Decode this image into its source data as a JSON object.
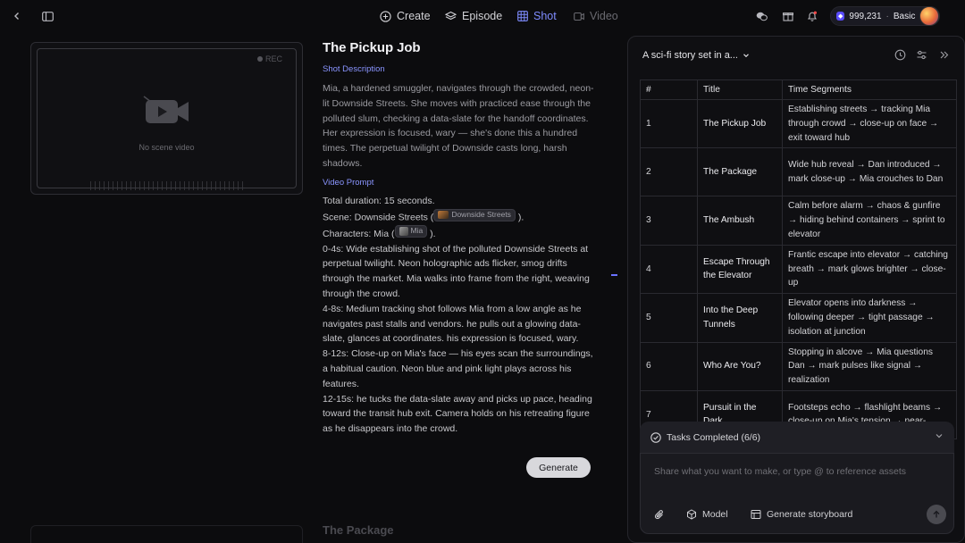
{
  "nav": {
    "create": "Create",
    "episode": "Episode",
    "shot": "Shot",
    "video": "Video"
  },
  "account": {
    "credits": "999,231",
    "plan": "Basic"
  },
  "preview": {
    "rec": "REC",
    "empty": "No scene video"
  },
  "shot": {
    "title": "The Pickup Job",
    "description_label": "Shot Description",
    "description": "Mia, a hardened smuggler, navigates through the crowded, neon-lit Downside Streets. She moves with practiced ease through the polluted slum, checking a data-slate for the handoff coordinates. Her expression is focused, wary — she's done this a hundred times. The perpetual twilight of Downside casts long, harsh shadows.",
    "prompt_label": "Video Prompt",
    "duration": "Total duration: 15 seconds.",
    "scene_prefix": "Scene: Downside Streets (",
    "scene_tag": "Downside Streets",
    "scene_suffix": ").",
    "characters_prefix": "Characters: Mia (",
    "character_tag": "Mia",
    "characters_suffix": ").",
    "beats": [
      "0-4s: Wide establishing shot of the polluted Downside Streets at perpetual twilight. Neon holographic ads flicker, smog drifts through the market. Mia walks into frame from the right, weaving through the crowd.",
      "4-8s: Medium tracking shot follows Mia from a low angle as he navigates past stalls and vendors. he pulls out a glowing data-slate, glances at coordinates. his expression is focused, wary.",
      "8-12s: Close-up on Mia's face — his eyes scan the surroundings, a habitual caution. Neon blue and pink light plays across his features.",
      "12-15s: he tucks the data-slate away and picks up pace, heading toward the transit hub exit. Camera holds on his retreating figure as he disappears into the crowd."
    ],
    "generate_label": "Generate"
  },
  "next_shot": {
    "title": "The Package"
  },
  "panel": {
    "title": "A sci-fi story set in a...",
    "columns": [
      "#",
      "Title",
      "Time Segments"
    ],
    "rows": [
      {
        "num": "1",
        "title": "The Pickup Job",
        "segments": "Establishing streets → tracking Mia through crowd → close-up on face → exit toward hub"
      },
      {
        "num": "2",
        "title": "The Package",
        "segments": "Wide hub reveal → Dan introduced → mark close-up → Mia crouches to Dan"
      },
      {
        "num": "3",
        "title": "The Ambush",
        "segments": "Calm before alarm → chaos & gunfire → hiding behind containers → sprint to elevator"
      },
      {
        "num": "4",
        "title": "Escape Through the Elevator",
        "segments": "Frantic escape into elevator → catching breath → mark glows brighter → close-up"
      },
      {
        "num": "5",
        "title": "Into the Deep Tunnels",
        "segments": "Elevator opens into darkness → following deeper → tight passage → isolation at junction"
      },
      {
        "num": "6",
        "title": "Who Are You?",
        "segments": "Stopping in alcove → Mia questions Dan → mark pulses like signal → realization"
      },
      {
        "num": "7",
        "title": "Pursuit in the Dark",
        "segments": "Footsteps echo → flashlight beams → close-up on Mia's tension → near-"
      }
    ],
    "tasks_label": "Tasks Completed (6/6)",
    "composer_placeholder": "Share what you want to make, or type @ to reference assets",
    "model_label": "Model",
    "storyboard_label": "Generate storyboard"
  }
}
